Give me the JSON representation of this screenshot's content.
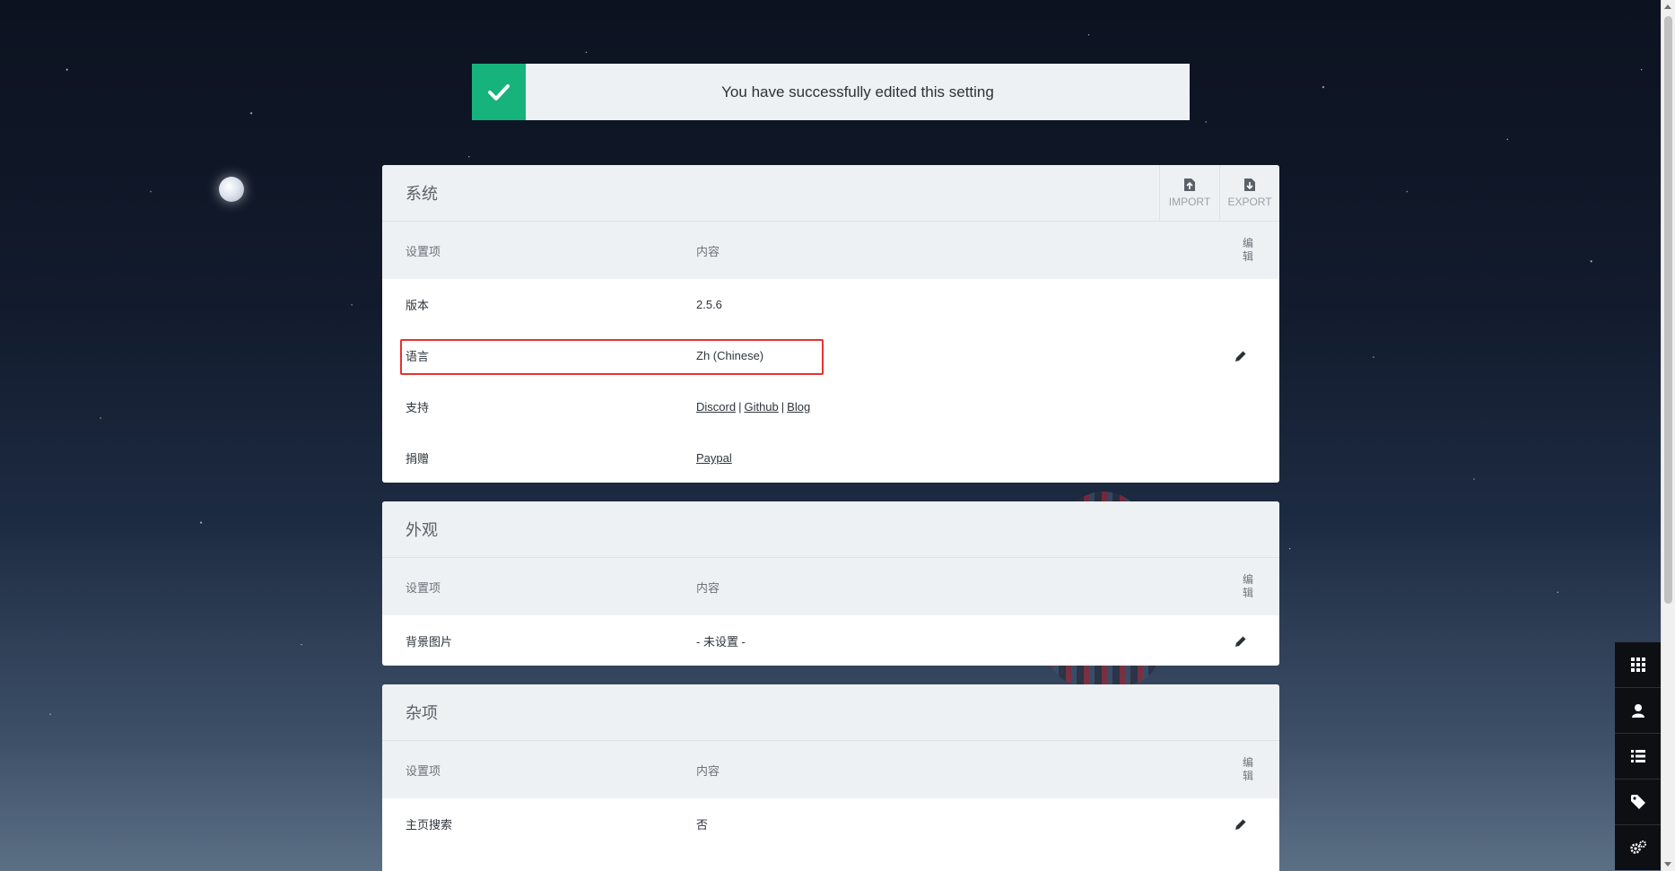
{
  "alert": {
    "message": "You have successfully edited this setting",
    "icon": "check-icon",
    "accent": "#17b37c"
  },
  "sections": [
    {
      "title": "系统",
      "actions": [
        {
          "label": "IMPORT",
          "icon": "import-icon"
        },
        {
          "label": "EXPORT",
          "icon": "export-icon"
        }
      ],
      "headers": {
        "item": "设置项",
        "content": "内容",
        "edit": "编辑"
      },
      "rows": [
        {
          "label": "版本",
          "value": "2.5.6"
        },
        {
          "label": "语言",
          "value": "Zh (Chinese)"
        },
        {
          "label": "支持",
          "links": [
            "Discord",
            "Github",
            "Blog"
          ],
          "sep": "|"
        },
        {
          "label": "捐赠",
          "links": [
            "Paypal"
          ]
        }
      ]
    },
    {
      "title": "外观",
      "headers": {
        "item": "设置项",
        "content": "内容",
        "edit": "编辑"
      },
      "rows": [
        {
          "label": "背景图片",
          "value": "- 未设置 -"
        }
      ]
    },
    {
      "title": "杂项",
      "headers": {
        "item": "设置项",
        "content": "内容",
        "edit": "编辑"
      },
      "rows": [
        {
          "label": "主页搜索",
          "value": "否"
        }
      ]
    }
  ],
  "dock": [
    "grid-icon",
    "user-icon",
    "list-icon",
    "tag-icon",
    "settings-icon"
  ],
  "highlight_color": "#e5322d"
}
